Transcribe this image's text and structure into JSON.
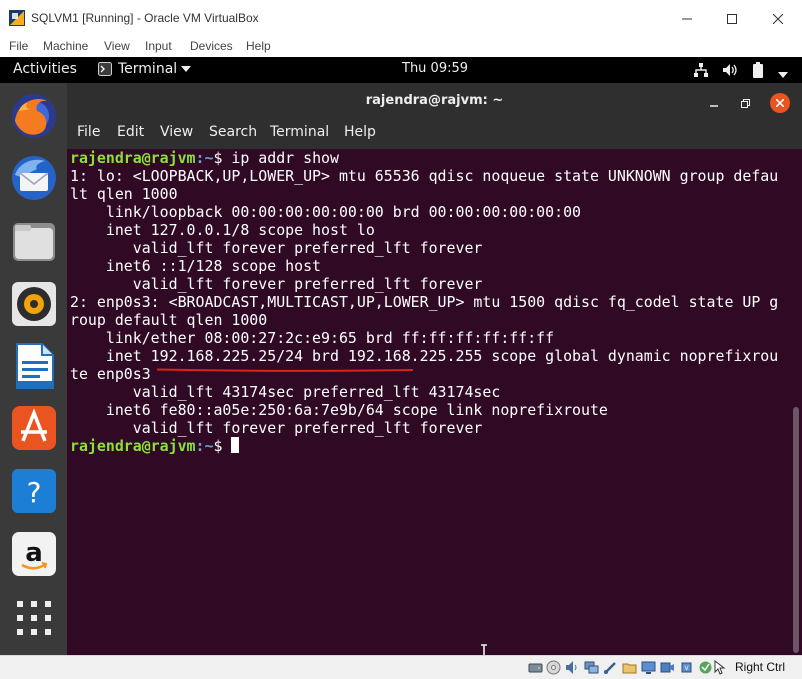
{
  "window": {
    "title": "SQLVM1 [Running] - Oracle VM VirtualBox",
    "menu": [
      "File",
      "Machine",
      "View",
      "Input",
      "Devices",
      "Help"
    ]
  },
  "topbar": {
    "activities": "Activities",
    "app_name": "Terminal",
    "clock": "Thu 09:59",
    "status_icons": [
      "network-icon",
      "volume-icon",
      "battery-icon",
      "power-menu-arrow"
    ]
  },
  "dock": {
    "items": [
      {
        "name": "firefox",
        "running": false
      },
      {
        "name": "thunderbird",
        "running": false
      },
      {
        "name": "files",
        "running": false
      },
      {
        "name": "rhythmbox",
        "running": false
      },
      {
        "name": "libreoffice-writer",
        "running": false
      },
      {
        "name": "ubuntu-software",
        "running": false
      },
      {
        "name": "help",
        "running": false
      },
      {
        "name": "amazon",
        "running": false
      },
      {
        "name": "show-applications",
        "running": false
      }
    ]
  },
  "terminal": {
    "title": "rajendra@rajvm: ~",
    "menu": [
      "File",
      "Edit",
      "View",
      "Search",
      "Terminal",
      "Help"
    ],
    "prompt_user": "rajendra@rajvm",
    "prompt_path": ":~",
    "prompt_symbol": "$",
    "command": " ip addr show",
    "output": [
      "1: lo: <LOOPBACK,UP,LOWER_UP> mtu 65536 qdisc noqueue state UNKNOWN group defau",
      "lt qlen 1000",
      "    link/loopback 00:00:00:00:00:00 brd 00:00:00:00:00:00",
      "    inet 127.0.0.1/8 scope host lo",
      "       valid_lft forever preferred_lft forever",
      "    inet6 ::1/128 scope host",
      "       valid_lft forever preferred_lft forever",
      "2: enp0s3: <BROADCAST,MULTICAST,UP,LOWER_UP> mtu 1500 qdisc fq_codel state UP g",
      "roup default qlen 1000",
      "    link/ether 08:00:27:2c:e9:65 brd ff:ff:ff:ff:ff:ff",
      "    inet 192.168.225.25/24 brd 192.168.225.255 scope global dynamic noprefixrou",
      "te enp0s3",
      "       valid_lft 43174sec preferred_lft 43174sec",
      "    inet6 fe80::a05e:250:6a:7e9b/64 scope link noprefixroute",
      "       valid_lft forever preferred_lft forever"
    ],
    "final_prompt_user": "rajendra@rajvm",
    "final_prompt_path": ":~",
    "final_prompt_symbol": "$ "
  },
  "statusbar": {
    "host_key": "Right Ctrl",
    "icons": [
      "hard-disk-icon",
      "optical-drive-icon",
      "audio-icon",
      "network-icon",
      "usb-icon",
      "shared-folders-icon",
      "display-icon",
      "video-capture-icon",
      "cpu-icon",
      "virtualization-icon",
      "mouse-integration-icon",
      "host-key-icon"
    ]
  },
  "colors": {
    "terminal_bg": "#300a24",
    "prompt_user": "#8ae234",
    "prompt_path": "#729fcf",
    "accent": "#e95420",
    "annotation": "#d9241a"
  }
}
